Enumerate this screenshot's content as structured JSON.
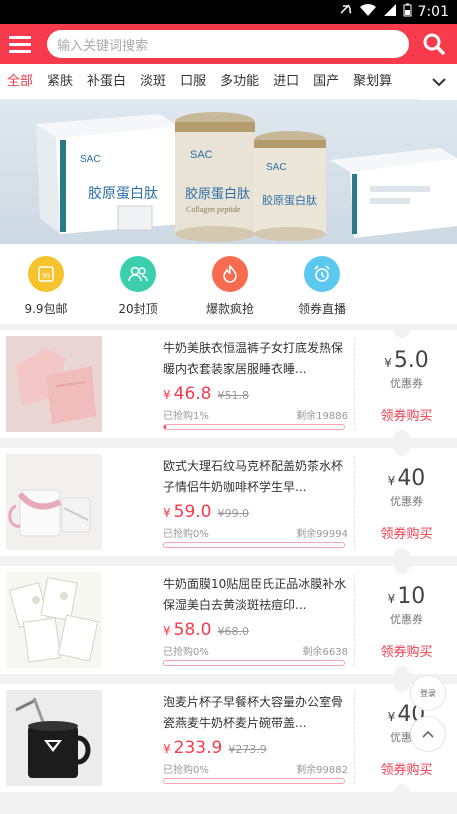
{
  "status_bar": {
    "time": "7:01"
  },
  "header": {
    "search_placeholder": "输入关键词搜索"
  },
  "tabs": [
    "全部",
    "紧肤",
    "补蛋白",
    "淡斑",
    "口服",
    "多功能",
    "进口",
    "国产",
    "聚划算"
  ],
  "banner": {
    "brand": "SAC",
    "product_text": "胶原蛋白肽",
    "product_text_en": "Collagen peptide"
  },
  "quick_links": [
    {
      "label": "9.9包邮",
      "icon": "price-tag-icon",
      "color": "#f5c42c",
      "badge": "99"
    },
    {
      "label": "20封顶",
      "icon": "users-icon",
      "color": "#3ccfae"
    },
    {
      "label": "爆款疯抢",
      "icon": "fire-icon",
      "color": "#f76c4e"
    },
    {
      "label": "领券直播",
      "icon": "alarm-clock-icon",
      "color": "#5ac8ef"
    }
  ],
  "products": [
    {
      "title": "牛奶美肤衣恒温裤子女打底发热保暖内衣套装家居服睡衣睡...",
      "price": "46.8",
      "orig_price": "51.8",
      "sold": "已抢购1%",
      "remain": "剩余19886",
      "progress": 0.01,
      "coupon": "5.0",
      "coupon_label": "优惠券",
      "buy_label": "领券购买"
    },
    {
      "title": "欧式大理石纹马克杯配盖奶茶水杯子情侣牛奶咖啡杯学生早...",
      "price": "59.0",
      "orig_price": "99.0",
      "sold": "已抢购0%",
      "remain": "剩余99994",
      "progress": 0.0,
      "coupon": "40",
      "coupon_label": "优惠券",
      "buy_label": "领券购买"
    },
    {
      "title": "牛奶面膜10贴屈臣氏正品冰膜补水保湿美白去黄淡斑祛痘印...",
      "price": "58.0",
      "orig_price": "68.0",
      "sold": "已抢购0%",
      "remain": "剩余6638",
      "progress": 0.0,
      "coupon": "10",
      "coupon_label": "优惠券",
      "buy_label": "领券购买"
    },
    {
      "title": "泡麦片杯子早餐杯大容量办公室骨瓷燕麦牛奶杯麦片碗带盖...",
      "price": "233.9",
      "orig_price": "273.9",
      "sold": "已抢购0%",
      "remain": "剩余99882",
      "progress": 0.0,
      "coupon": "40",
      "coupon_label": "优惠券",
      "buy_label": "领券购买"
    }
  ],
  "currency_symbol": "¥",
  "float": {
    "login_label": "登录"
  },
  "colors": {
    "brand_red": "#f73b4d"
  }
}
